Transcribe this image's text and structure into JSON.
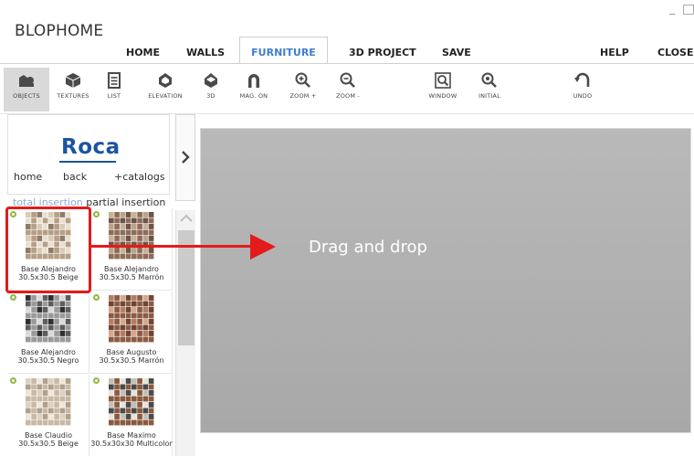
{
  "app": {
    "title": "BLOPHOME",
    "minimize_glyph": "_"
  },
  "menu": {
    "items": [
      "HOME",
      "WALLS",
      "FURNITURE",
      "3D PROJECT",
      "SAVE",
      "HELP",
      "CLOSE"
    ],
    "active": "FURNITURE",
    "active_color": "#3f7fd0"
  },
  "toolbar": {
    "tools": [
      {
        "label": "OBJECTS",
        "icon": "objects-icon",
        "selected": true
      },
      {
        "label": "TEXTURES",
        "icon": "textures-icon"
      },
      {
        "label": "LIST",
        "icon": "list-icon"
      },
      {
        "label": "ELEVATION",
        "icon": "elevation-icon"
      },
      {
        "label": "3D",
        "icon": "3d-icon"
      },
      {
        "label": "MAG. ON",
        "icon": "magnet-icon"
      },
      {
        "label": "ZOOM +",
        "icon": "zoom-in-icon"
      },
      {
        "label": "ZOOM -",
        "icon": "zoom-out-icon"
      },
      {
        "label": "WINDOW",
        "icon": "zoom-window-icon"
      },
      {
        "label": "INITIAL",
        "icon": "zoom-initial-icon"
      },
      {
        "label": "UNDO",
        "icon": "undo-icon"
      }
    ]
  },
  "brand": {
    "logo": "Roca",
    "logo_color": "#1c54a0",
    "links": [
      "home",
      "back",
      "+catalogs"
    ]
  },
  "insertion": {
    "total": "total insertion",
    "partial": "partial insertion"
  },
  "catalog": {
    "items": [
      {
        "line1": "Base Alejandro",
        "line2": "30.5x30.5 Beige",
        "swatch": [
          "#d8cbb6",
          "#b79f85",
          "#8e7a66",
          "#e9e0d0"
        ]
      },
      {
        "line1": "Base Alejandro",
        "line2": "30.5x30.5 Marrón",
        "swatch": [
          "#c8b196",
          "#8f6c57",
          "#b8a58e",
          "#6e5446"
        ]
      },
      {
        "line1": "Base Alejandro",
        "line2": "30.5x30.5 Negro",
        "swatch": [
          "#2e2e2e",
          "#9a9a9a",
          "#dadada",
          "#5d5d5d"
        ]
      },
      {
        "line1": "Base Augusto",
        "line2": "30.5x30.5 Marrón",
        "swatch": [
          "#b47d61",
          "#8c5a43",
          "#d5a88d",
          "#6f4433"
        ]
      },
      {
        "line1": "Base Claudio",
        "line2": "30.5x30.5 Beige",
        "swatch": [
          "#ddd2c2",
          "#c8b9a5",
          "#efe7da",
          "#b0a08c"
        ]
      },
      {
        "line1": "Base Maximo",
        "line2": "30.5x30x30 Multicolor",
        "swatch": [
          "#c4c0b8",
          "#8a5a3c",
          "#e8e4dc",
          "#4a4a4a"
        ]
      }
    ]
  },
  "canvas": {
    "annotation": "Drag and drop"
  },
  "annotation_color": "#e41b1b"
}
